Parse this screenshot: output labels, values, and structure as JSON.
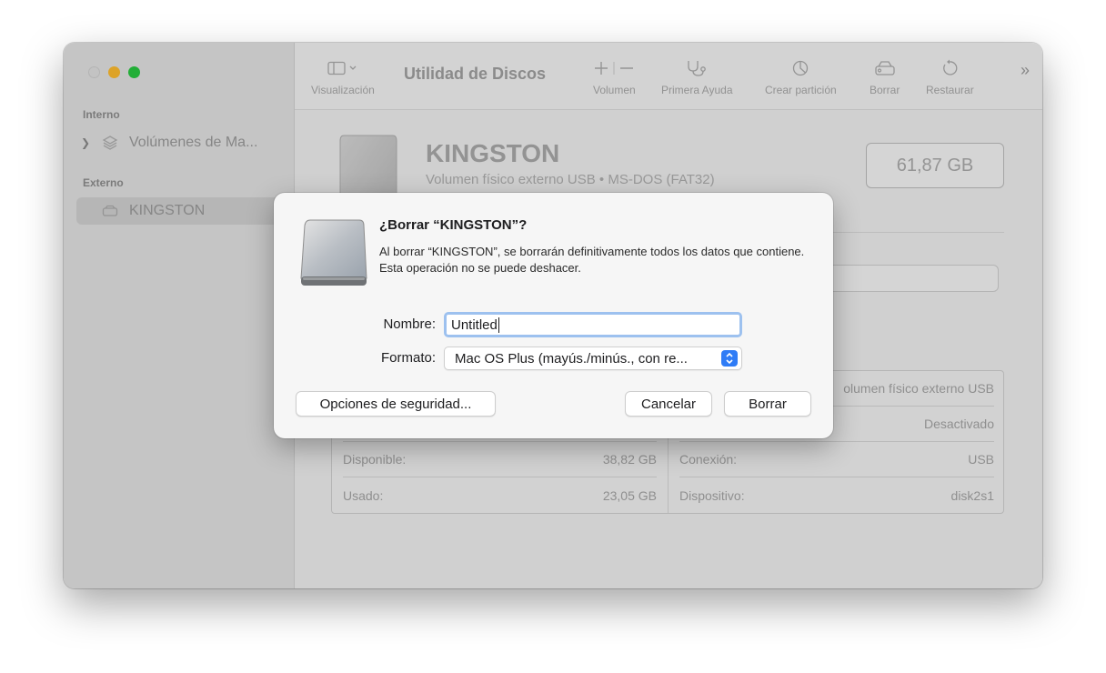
{
  "window": {
    "toolbar": {
      "view_label": "Visualización",
      "title": "Utilidad de Discos",
      "volume_label": "Volumen",
      "first_aid_label": "Primera Ayuda",
      "partition_label": "Crear partición",
      "erase_label": "Borrar",
      "restore_label": "Restaurar",
      "more": "»"
    },
    "sidebar": {
      "internal_header": "Interno",
      "internal_item": "Volúmenes de Ma...",
      "external_header": "Externo",
      "external_item": "KINGSTON"
    },
    "disk": {
      "name": "KINGSTON",
      "subtitle": "Volumen físico externo USB • MS-DOS (FAT32)",
      "capacity": "61,87 GB"
    },
    "info": {
      "left": [
        {
          "label": "",
          "value": ""
        },
        {
          "label": "",
          "value": ""
        },
        {
          "label": "Disponible:",
          "value": "38,82 GB"
        },
        {
          "label": "Usado:",
          "value": "23,05 GB"
        }
      ],
      "right": [
        {
          "label": "",
          "value": "olumen físico externo USB"
        },
        {
          "label": "",
          "value": "Desactivado"
        },
        {
          "label": "Conexión:",
          "value": "USB"
        },
        {
          "label": "Dispositivo:",
          "value": "disk2s1"
        }
      ]
    }
  },
  "dialog": {
    "title": "¿Borrar “KINGSTON”?",
    "message": "Al borrar “KINGSTON”, se borrarán definitivamente todos los datos que contiene. Esta operación no se puede deshacer.",
    "name_label": "Nombre:",
    "name_value": "Untitled",
    "format_label": "Formato:",
    "format_value": "Mac OS Plus (mayús./minús., con re...",
    "security_button": "Opciones de seguridad...",
    "cancel_button": "Cancelar",
    "erase_button": "Borrar"
  },
  "colors": {
    "accent": "#2f7cf6",
    "traffic_min": "#febc2e",
    "traffic_max": "#28c840",
    "focus_ring": "#9dc1ef"
  }
}
